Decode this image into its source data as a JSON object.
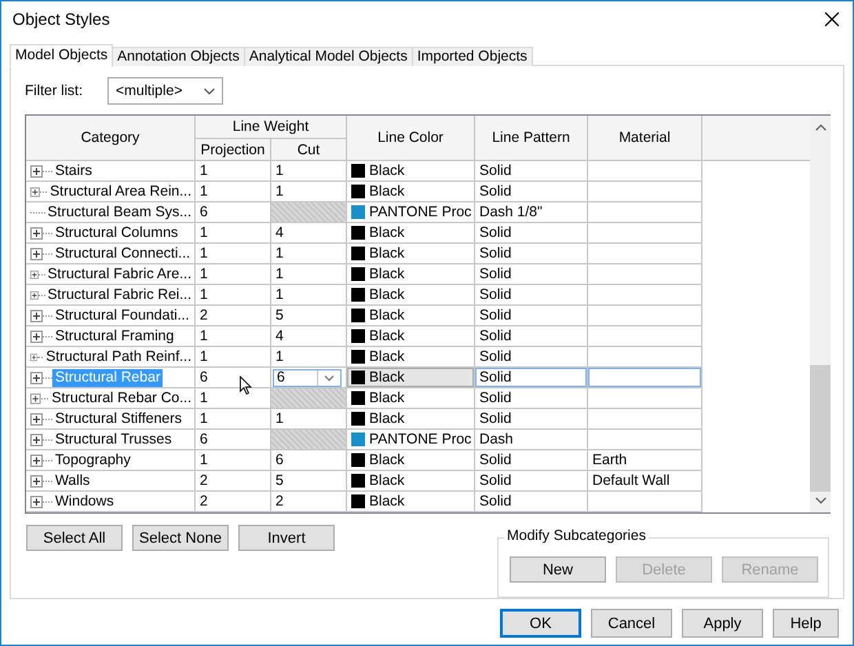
{
  "window": {
    "title": "Object Styles"
  },
  "tabs": [
    {
      "label": "Model Objects",
      "selected": true
    },
    {
      "label": "Annotation Objects",
      "selected": false
    },
    {
      "label": "Analytical Model Objects",
      "selected": false
    },
    {
      "label": "Imported Objects",
      "selected": false
    }
  ],
  "filter": {
    "label": "Filter list:",
    "value": "<multiple>"
  },
  "table": {
    "headers": {
      "category": "Category",
      "line_weight": "Line Weight",
      "projection": "Projection",
      "cut": "Cut",
      "line_color": "Line Color",
      "line_pattern": "Line Pattern",
      "material": "Material"
    },
    "rows": [
      {
        "category": "Stairs",
        "expandable": true,
        "projection": "1",
        "cut": "1",
        "cut_enabled": true,
        "color": "#000000",
        "line_color": "Black",
        "line_pattern": "Solid",
        "selected": false
      },
      {
        "category": "Structural Area Rein...",
        "expandable": true,
        "projection": "1",
        "cut": "1",
        "cut_enabled": true,
        "color": "#000000",
        "line_color": "Black",
        "line_pattern": "Solid",
        "selected": false
      },
      {
        "category": "Structural Beam Sys...",
        "expandable": false,
        "projection": "6",
        "cut_enabled": false,
        "color": "#1a8fc9",
        "line_color": "PANTONE Proc",
        "line_pattern": "Dash 1/8\"",
        "selected": false
      },
      {
        "category": "Structural Columns",
        "expandable": true,
        "projection": "1",
        "cut": "4",
        "cut_enabled": true,
        "color": "#000000",
        "line_color": "Black",
        "line_pattern": "Solid",
        "selected": false
      },
      {
        "category": "Structural Connecti...",
        "expandable": true,
        "projection": "1",
        "cut": "1",
        "cut_enabled": true,
        "color": "#000000",
        "line_color": "Black",
        "line_pattern": "Solid",
        "selected": false
      },
      {
        "category": "Structural Fabric Are...",
        "expandable": true,
        "projection": "1",
        "cut": "1",
        "cut_enabled": true,
        "color": "#000000",
        "line_color": "Black",
        "line_pattern": "Solid",
        "selected": false
      },
      {
        "category": "Structural Fabric Rei...",
        "expandable": true,
        "projection": "1",
        "cut": "1",
        "cut_enabled": true,
        "color": "#000000",
        "line_color": "Black",
        "line_pattern": "Solid",
        "selected": false
      },
      {
        "category": "Structural Foundati...",
        "expandable": true,
        "projection": "2",
        "cut": "5",
        "cut_enabled": true,
        "color": "#000000",
        "line_color": "Black",
        "line_pattern": "Solid",
        "selected": false
      },
      {
        "category": "Structural Framing",
        "expandable": true,
        "projection": "1",
        "cut": "4",
        "cut_enabled": true,
        "color": "#000000",
        "line_color": "Black",
        "line_pattern": "Solid",
        "selected": false
      },
      {
        "category": "Structural Path Reinf...",
        "expandable": true,
        "projection": "1",
        "cut": "1",
        "cut_enabled": true,
        "color": "#000000",
        "line_color": "Black",
        "line_pattern": "Solid",
        "selected": false
      },
      {
        "category": "Structural Rebar",
        "expandable": true,
        "projection": "6",
        "cut": "6",
        "cut_enabled": true,
        "color": "#000000",
        "line_color": "Black",
        "line_pattern": "Solid",
        "selected": true
      },
      {
        "category": "Structural Rebar Co...",
        "expandable": true,
        "projection": "1",
        "cut_enabled": false,
        "color": "#000000",
        "line_color": "Black",
        "line_pattern": "Solid",
        "selected": false
      },
      {
        "category": "Structural Stiffeners",
        "expandable": true,
        "projection": "1",
        "cut": "1",
        "cut_enabled": true,
        "color": "#000000",
        "line_color": "Black",
        "line_pattern": "Solid",
        "selected": false
      },
      {
        "category": "Structural Trusses",
        "expandable": true,
        "projection": "6",
        "cut_enabled": false,
        "color": "#1a8fc9",
        "line_color": "PANTONE Proc",
        "line_pattern": "Dash",
        "selected": false
      },
      {
        "category": "Topography",
        "expandable": true,
        "projection": "1",
        "cut": "6",
        "cut_enabled": true,
        "color": "#000000",
        "line_color": "Black",
        "line_pattern": "Solid",
        "material": "Earth",
        "selected": false
      },
      {
        "category": "Walls",
        "expandable": true,
        "projection": "2",
        "cut": "5",
        "cut_enabled": true,
        "color": "#000000",
        "line_color": "Black",
        "line_pattern": "Solid",
        "material": "Default Wall",
        "selected": false
      },
      {
        "category": "Windows",
        "expandable": true,
        "projection": "2",
        "cut": "2",
        "cut_enabled": true,
        "color": "#000000",
        "line_color": "Black",
        "line_pattern": "Solid",
        "selected": false
      }
    ]
  },
  "selection_buttons": [
    {
      "label": "Select All"
    },
    {
      "label": "Select None"
    },
    {
      "label": "Invert"
    }
  ],
  "modify_subcategories": {
    "title": "Modify Subcategories",
    "buttons": [
      {
        "label": "New",
        "disabled": false
      },
      {
        "label": "Delete",
        "disabled": true
      },
      {
        "label": "Rename",
        "disabled": true
      }
    ]
  },
  "dialog_buttons": [
    {
      "label": "OK",
      "default": true
    },
    {
      "label": "Cancel",
      "default": false
    },
    {
      "label": "Apply",
      "default": false
    },
    {
      "label": "Help",
      "default": false
    }
  ]
}
